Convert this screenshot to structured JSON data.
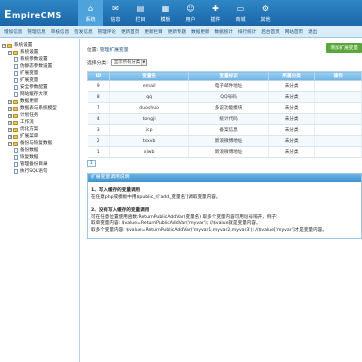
{
  "header": {
    "logo": "EmpireCMS",
    "logo_big": "E",
    "nav": [
      {
        "label": "系统",
        "icon": "home-icon",
        "glyph": "⌂"
      },
      {
        "label": "信息",
        "icon": "info-icon",
        "glyph": "✉"
      },
      {
        "label": "栏目",
        "icon": "folder-icon",
        "glyph": "▤"
      },
      {
        "label": "模板",
        "icon": "template-icon",
        "glyph": "▦"
      },
      {
        "label": "用户",
        "icon": "user-icon",
        "glyph": "☺"
      },
      {
        "label": "插件",
        "icon": "plugin-icon",
        "glyph": "✚"
      },
      {
        "label": "商城",
        "icon": "cart-icon",
        "glyph": "▭"
      },
      {
        "label": "其他",
        "icon": "gear-icon",
        "glyph": "⚙"
      }
    ]
  },
  "subnav": [
    "增加信息",
    "管理信息",
    "审核信息",
    "签发信息",
    "管理评论",
    "更新首页",
    "更新栏目",
    "更新专题",
    "数据更新",
    "数据统计",
    "排行统计",
    "后台首页",
    "网站首页",
    "退出"
  ],
  "tree": [
    {
      "label": "系统设置",
      "level": 0,
      "type": "folder",
      "pm": "−"
    },
    {
      "label": "系统设置",
      "level": 1,
      "type": "folder",
      "pm": "−"
    },
    {
      "label": "系统参数设置",
      "level": 2,
      "type": "doc"
    },
    {
      "label": "伪静态参数设置",
      "level": 2,
      "type": "doc"
    },
    {
      "label": "扩展变量",
      "level": 2,
      "type": "doc"
    },
    {
      "label": "扩展变量",
      "level": 2,
      "type": "doc"
    },
    {
      "label": "安全参数配置",
      "level": 2,
      "type": "doc"
    },
    {
      "label": "网站缓存大项",
      "level": 2,
      "type": "doc"
    },
    {
      "label": "数据更新",
      "level": 1,
      "type": "folder",
      "pm": "+"
    },
    {
      "label": "数据表与系统模型",
      "level": 1,
      "type": "folder",
      "pm": "+"
    },
    {
      "label": "计划任务",
      "level": 1,
      "type": "folder",
      "pm": "+"
    },
    {
      "label": "工作流",
      "level": 1,
      "type": "folder",
      "pm": "+"
    },
    {
      "label": "优化方案",
      "level": 1,
      "type": "folder",
      "pm": "+"
    },
    {
      "label": "扩展菜单",
      "level": 1,
      "type": "folder",
      "pm": "+"
    },
    {
      "label": "备份与恢复数据",
      "level": 1,
      "type": "folder",
      "pm": "−"
    },
    {
      "label": "备份数据",
      "level": 2,
      "type": "doc"
    },
    {
      "label": "恢复数据",
      "level": 2,
      "type": "doc"
    },
    {
      "label": "管理备份目录",
      "level": 2,
      "type": "doc"
    },
    {
      "label": "执行SQL语句",
      "level": 2,
      "type": "doc"
    }
  ],
  "main": {
    "position_label": "位置:",
    "position_link": "管理扩展变量",
    "add_button": "增加扩展变量",
    "select_label": "选择分类:",
    "select_value": "显示所有分类",
    "columns": [
      "ID",
      "变量名",
      "变量标识",
      "所属分类",
      "操作"
    ],
    "rows": [
      {
        "id": "9",
        "name": "email",
        "mark": "电子邮件地址",
        "cat": "未分类"
      },
      {
        "id": "8",
        "name": "qq",
        "mark": "QQ号码",
        "cat": "未分类"
      },
      {
        "id": "7",
        "name": "duoshuo",
        "mark": "多说功能模块",
        "cat": "未分类"
      },
      {
        "id": "4",
        "name": "tongji",
        "mark": "统计代码",
        "cat": "未分类"
      },
      {
        "id": "3",
        "name": "icp",
        "mark": "备案信息",
        "cat": "未分类"
      },
      {
        "id": "2",
        "name": "tsxvb",
        "mark": "新浪微博地址",
        "cat": "未分类"
      },
      {
        "id": "1",
        "name": "xlwb",
        "mark": "新浪微博地址",
        "cat": "未分类"
      }
    ],
    "pager": "1",
    "help": {
      "title": "扩展变量调用说明",
      "t1": "1、写入缓存的变量调用",
      "l1": "在任意php或模板中用$public_r['add_变量名']调取变量内容。",
      "t2": "2、没有写入缓存的变量调用",
      "l2": "可在任意位置使用函数:ReturnPublicAddVar(变量名) 取多个变量内容可用逗号隔开，例子:",
      "l3": "取单变量内容: $value=ReturnPublicAddVar('myvar'); //$value就是变量内容。",
      "l4": "取多个变量内容: $value=ReturnPublicAddVar('myvar1,myvar2,myvar3'); //$value['myvar']才是变量内容。"
    }
  }
}
